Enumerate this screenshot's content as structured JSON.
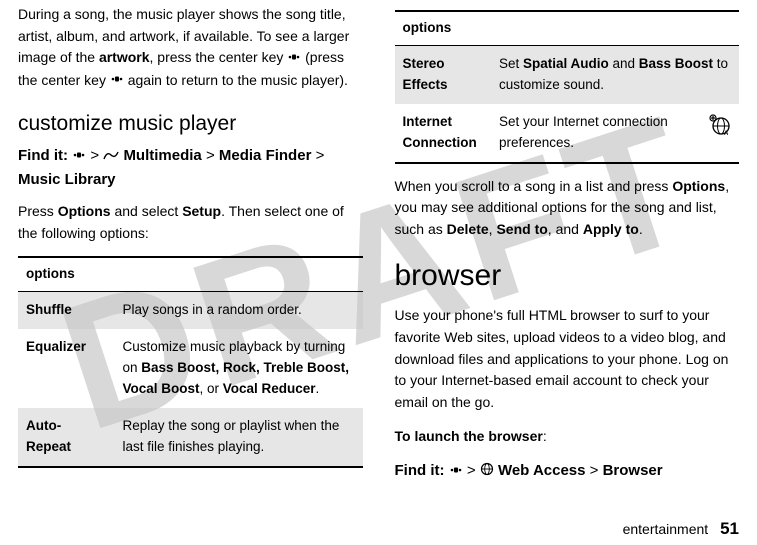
{
  "watermark": "DRAFT",
  "left": {
    "intro": "During a song, the music player shows the song title, artist, album, and artwork, if available. To see a larger image of the ",
    "artwork_word": "artwork",
    "intro2": ", press the center key ",
    "intro3": " (press the center key ",
    "intro4": " again to return to the music player).",
    "customize_heading": "customize music player",
    "findit_label": "Find it:",
    "findit_path1": "Multimedia",
    "findit_path2": "Media Finder",
    "findit_path3": "Music Library",
    "press_text1": "Press ",
    "press_options": "Options",
    "press_text2": " and select ",
    "press_setup": "Setup",
    "press_text3": ". Then select one of the following options:",
    "table_header": "options",
    "rows": [
      {
        "name": "Shuffle",
        "desc": "Play songs in a random order."
      },
      {
        "name": "Equalizer",
        "desc_pre": "Customize music playback by turning on ",
        "opts": "Bass Boost, Rock, Treble Boost, Vocal Boost",
        "desc_mid": ", or ",
        "opts2": "Vocal Reducer",
        "desc_post": "."
      },
      {
        "name": "Auto- Repeat",
        "desc": "Replay the song or playlist when the last file finishes playing."
      }
    ]
  },
  "right": {
    "table_header": "options",
    "rows": [
      {
        "name": "Stereo Effects",
        "desc_pre": "Set ",
        "b1": "Spatial Audio",
        "mid": " and ",
        "b2": "Bass Boost",
        "desc_post": " to customize sound."
      },
      {
        "name": "Internet Connection",
        "desc": "Set your Internet connection preferences."
      }
    ],
    "scroll_text1": "When you scroll to a song in a list and press ",
    "scroll_options": "Options",
    "scroll_text2": ", you may see additional options for the song and list, such as ",
    "scroll_b1": "Delete",
    "scroll_b2": "Send to",
    "scroll_b3": "Apply to",
    "browser_heading": "browser",
    "browser_para": "Use your phone's full HTML browser to surf to your favorite Web sites, upload videos to a video blog, and download files and applications to your phone. Log on to your Internet-based email account to check your email on the go.",
    "launch_label": "To launch the browser",
    "findit_label": "Find it:",
    "findit_web": "Web Access",
    "findit_browser": "Browser"
  },
  "footer": {
    "section": "entertainment",
    "page": "51"
  }
}
